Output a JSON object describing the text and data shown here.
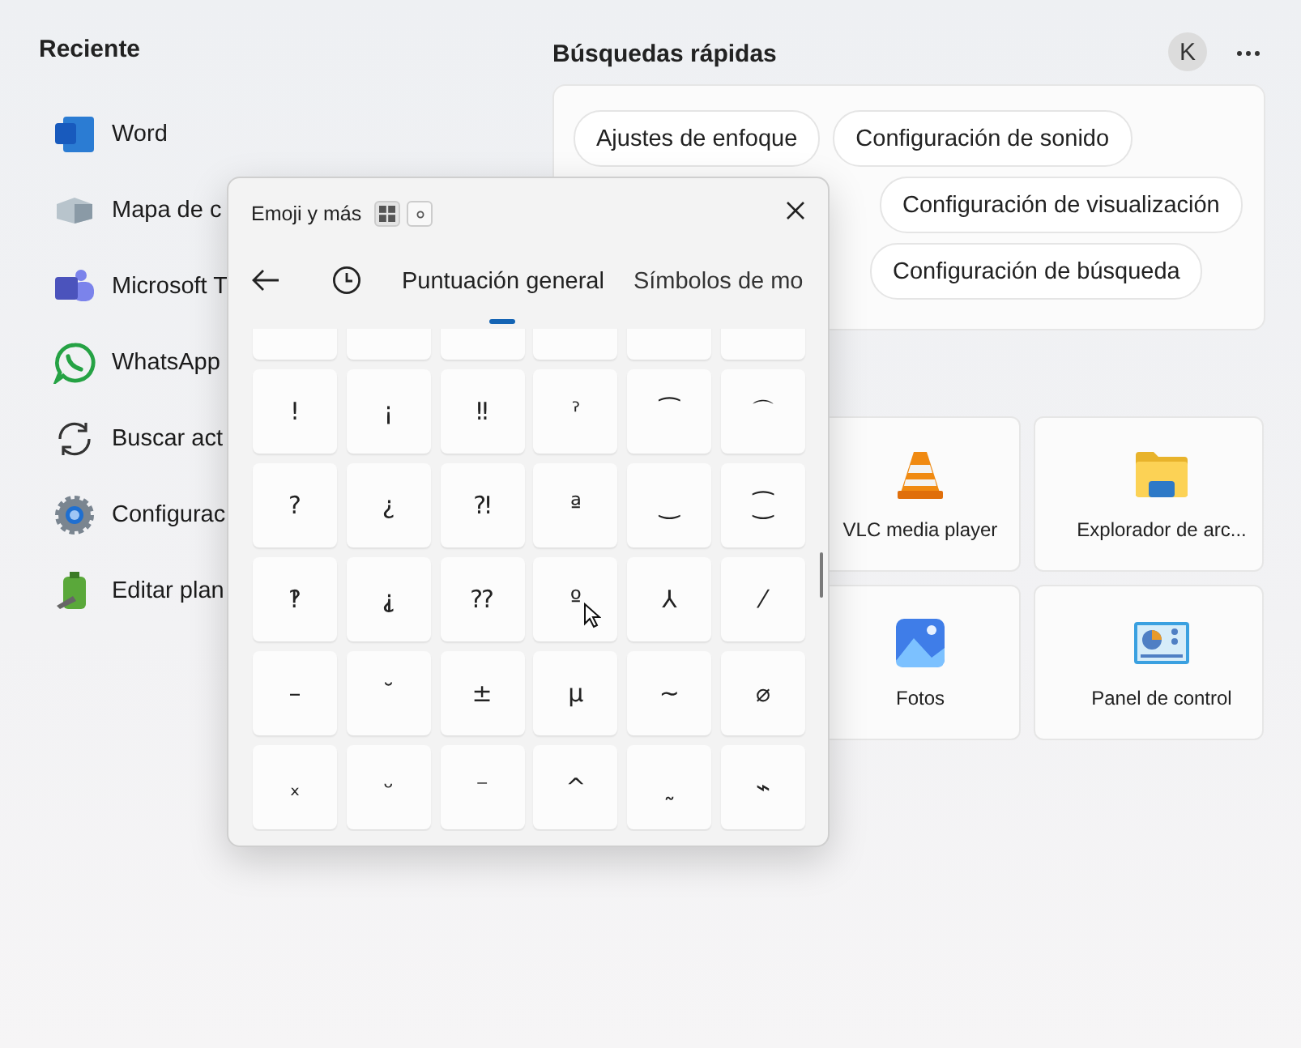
{
  "recent": {
    "title": "Reciente",
    "items": [
      {
        "label": "Word",
        "kind": "word"
      },
      {
        "label": "Mapa de c",
        "kind": "charmap"
      },
      {
        "label": "Microsoft T",
        "kind": "teams"
      },
      {
        "label": "WhatsApp",
        "kind": "whatsapp"
      },
      {
        "label": "Buscar act",
        "kind": "update"
      },
      {
        "label": "Configurac",
        "kind": "settings"
      },
      {
        "label": "Editar plan",
        "kind": "power"
      }
    ]
  },
  "quick_searches": {
    "title": "Búsquedas rápidas",
    "rows": [
      [
        "Ajustes de enfoque",
        "Configuración de sonido"
      ],
      [
        "Configuración de visualización"
      ],
      [
        "Configuración de búsqueda"
      ]
    ]
  },
  "account": {
    "initial": "K"
  },
  "pinned": [
    {
      "label": "VLC media player",
      "kind": "vlc"
    },
    {
      "label": "Explorador de arc...",
      "kind": "explorer"
    },
    {
      "label": "Fotos",
      "kind": "photos"
    },
    {
      "label": "Panel de control",
      "kind": "control"
    }
  ],
  "emoji_panel": {
    "title": "Emoji y más",
    "tabs": [
      {
        "label": "Puntuación general",
        "selected": true
      },
      {
        "label": "Símbolos de mo",
        "selected": false
      }
    ],
    "symbols": [
      "!",
      "¡",
      "‼",
      "ˀ",
      "⁀",
      "⌒",
      "?",
      "¿",
      "⁈",
      "ª",
      "‿",
      "⁐",
      "‽",
      "⸘",
      "⁇",
      "º",
      "⅄",
      "⁄",
      "–",
      "˘",
      "±",
      "µ",
      "∼",
      "⌀",
      "ₓ",
      "ᵕ",
      "⁻",
      "^",
      "˷",
      "⌁"
    ]
  }
}
